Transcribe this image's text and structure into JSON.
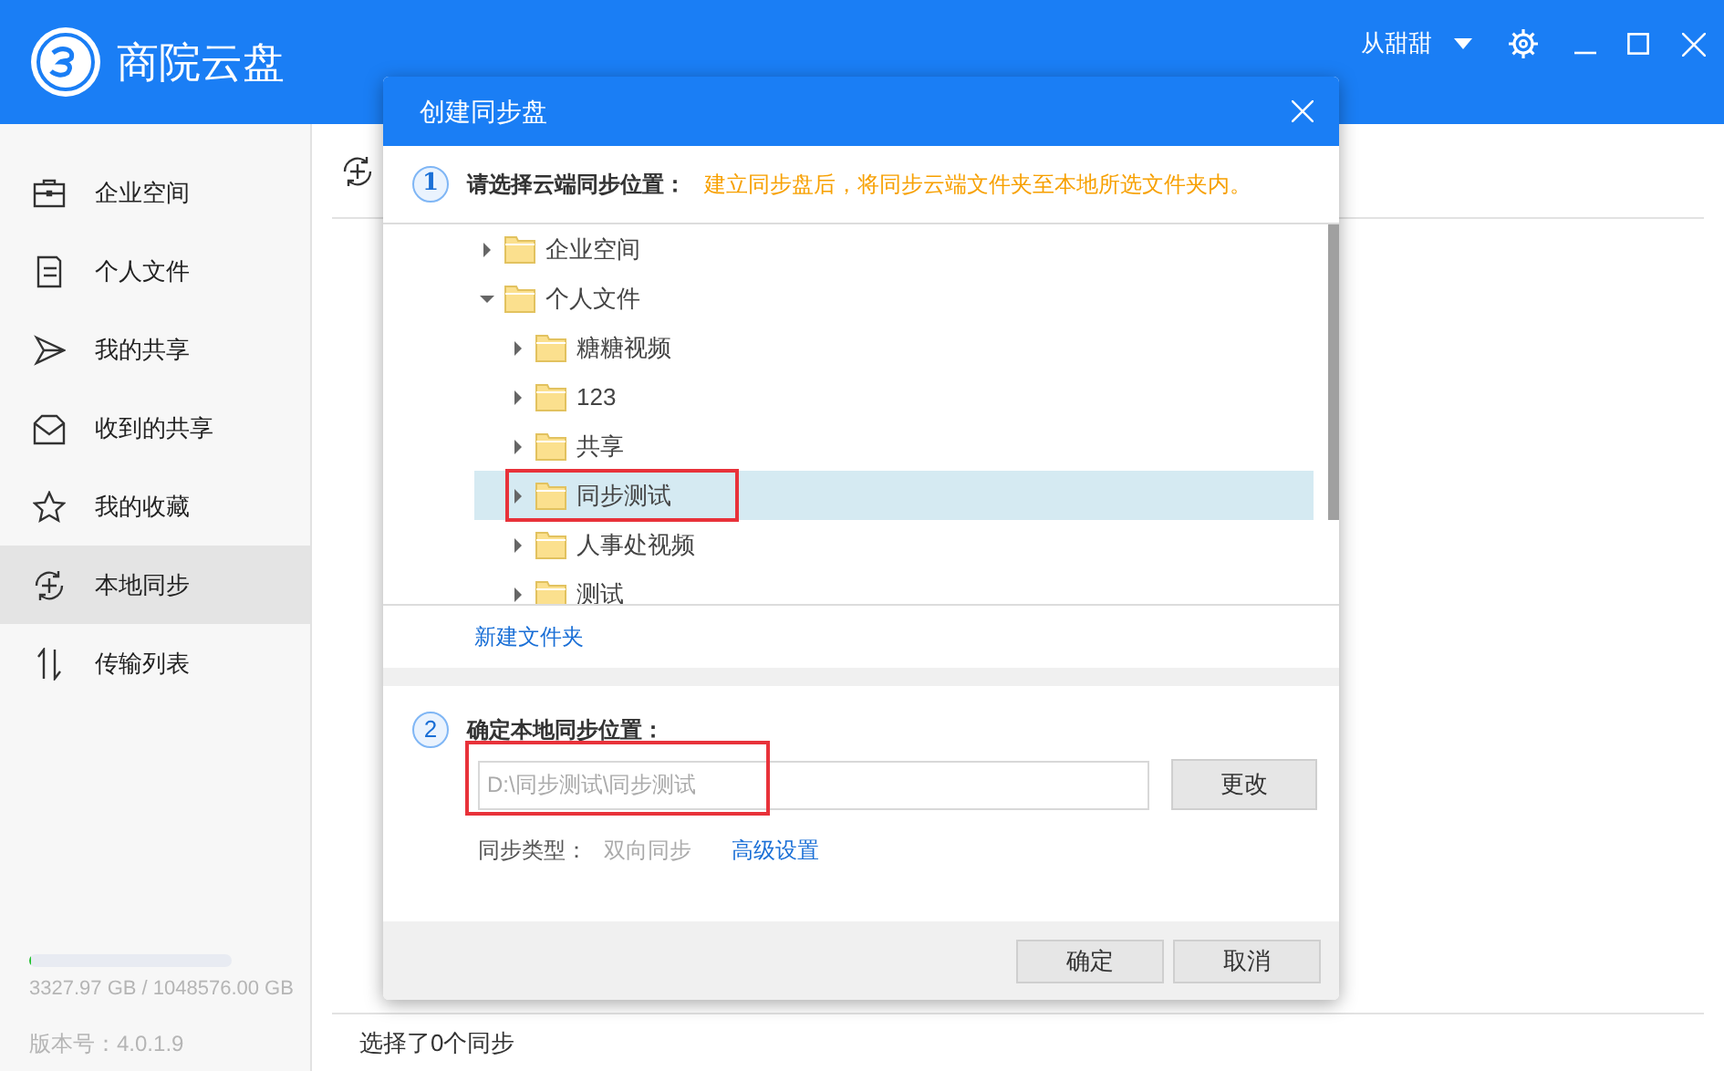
{
  "app": {
    "title": "商院云盘",
    "user": "从甜甜"
  },
  "sidebar": {
    "items": [
      {
        "label": "企业空间",
        "kind": "briefcase",
        "selected": false
      },
      {
        "label": "个人文件",
        "kind": "file",
        "selected": false
      },
      {
        "label": "我的共享",
        "kind": "send",
        "selected": false
      },
      {
        "label": "收到的共享",
        "kind": "inbox",
        "selected": false
      },
      {
        "label": "我的收藏",
        "kind": "star",
        "selected": false
      },
      {
        "label": "本地同步",
        "kind": "sync",
        "selected": true
      },
      {
        "label": "传输列表",
        "kind": "transfer",
        "selected": false
      }
    ],
    "storage": {
      "level": 0.004,
      "text": "3327.97 GB / 1048576.00 GB"
    },
    "version": "版本号：4.0.1.9"
  },
  "status_bar": "选择了0个同步",
  "dialog": {
    "title": "创建同步盘",
    "step1": {
      "number": "1",
      "label": "请选择云端同步位置：",
      "hint": "建立同步盘后，将同步云端文件夹至本地所选文件夹内。"
    },
    "tree": [
      {
        "label": "企业空间",
        "expanded": false,
        "selected": false,
        "highlighted": false
      },
      {
        "label": "个人文件",
        "expanded": true,
        "selected": false,
        "highlighted": false,
        "children": [
          {
            "label": "糖糖视频",
            "expanded": false,
            "selected": false,
            "highlighted": false
          },
          {
            "label": "123",
            "expanded": false,
            "selected": false,
            "highlighted": false
          },
          {
            "label": "共享",
            "expanded": false,
            "selected": false,
            "highlighted": false
          },
          {
            "label": "同步测试",
            "expanded": false,
            "selected": true,
            "highlighted": true
          },
          {
            "label": "人事处视频",
            "expanded": false,
            "selected": false,
            "highlighted": false
          },
          {
            "label": "测试",
            "expanded": false,
            "selected": false,
            "highlighted": false
          }
        ]
      }
    ],
    "new_folder": "新建文件夹",
    "step2": {
      "number": "2",
      "label": "确定本地同步位置：",
      "path": "D:\\同步测试\\同步测试",
      "highlighted": true,
      "change_button": "更改"
    },
    "sync_type": {
      "label": "同步类型：",
      "value": "双向同步",
      "link": "高级设置"
    },
    "buttons": [
      "确定",
      "取消"
    ]
  }
}
